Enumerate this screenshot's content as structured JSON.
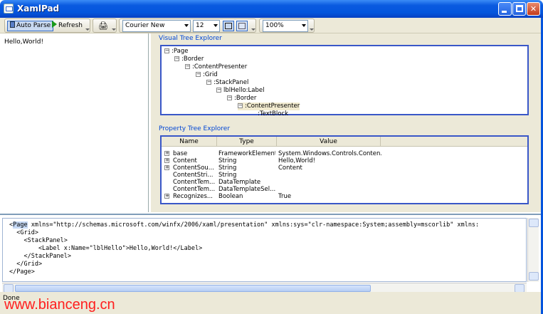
{
  "window": {
    "title": "XamlPad"
  },
  "toolbar": {
    "auto_parse": "Auto Parse",
    "refresh": "Refresh",
    "font": "Courier New",
    "size": "12",
    "zoom": "100%"
  },
  "editor": {
    "text": "Hello,World!"
  },
  "visual_tree": {
    "title": "Visual Tree Explorer",
    "nodes": [
      {
        "label": ":Page",
        "sign": "−"
      },
      {
        "label": ":Border",
        "sign": "−"
      },
      {
        "label": ":ContentPresenter",
        "sign": "−"
      },
      {
        "label": ":Grid",
        "sign": "−"
      },
      {
        "label": ":StackPanel",
        "sign": "−"
      },
      {
        "label": "lblHello:Label",
        "sign": "−"
      },
      {
        "label": ":Border",
        "sign": "−"
      },
      {
        "label": ":ContentPresenter",
        "sign": "−"
      },
      {
        "label": ":TextBlock",
        "sign": ""
      }
    ]
  },
  "property_tree": {
    "title": "Property Tree Explorer",
    "columns": [
      "Name",
      "Type",
      "Value"
    ],
    "rows": [
      {
        "expand": "+",
        "name": "base",
        "type": "FrameworkElement",
        "value": "System.Windows.Controls.Conten..."
      },
      {
        "expand": "+",
        "name": "Content",
        "type": "String",
        "value": "Hello,World!"
      },
      {
        "expand": "+",
        "name": "ContentSou...",
        "type": "String",
        "value": "Content"
      },
      {
        "expand": "",
        "name": "ContentStri...",
        "type": "String",
        "value": ""
      },
      {
        "expand": "",
        "name": "ContentTem...",
        "type": "DataTemplate",
        "value": ""
      },
      {
        "expand": "",
        "name": "ContentTem...",
        "type": "DataTemplateSel...",
        "value": ""
      },
      {
        "expand": "+",
        "name": "Recognizes...",
        "type": "Boolean",
        "value": "True"
      }
    ]
  },
  "code": {
    "first_token": "Page",
    "first_rest": " xmlns=\"http://schemas.microsoft.com/winfx/2006/xaml/presentation\" xmlns:sys=\"clr-namespace:System;assembly=mscorlib\" xmlns:",
    "lines": [
      "  <Grid>",
      "    <StackPanel>",
      "        <Label x:Name=\"lblHello\">Hello,World!</Label>",
      "    </StackPanel>",
      "  </Grid>",
      "</Page>"
    ]
  },
  "status": {
    "text": "Done"
  },
  "watermark": "www.bianceng.cn"
}
